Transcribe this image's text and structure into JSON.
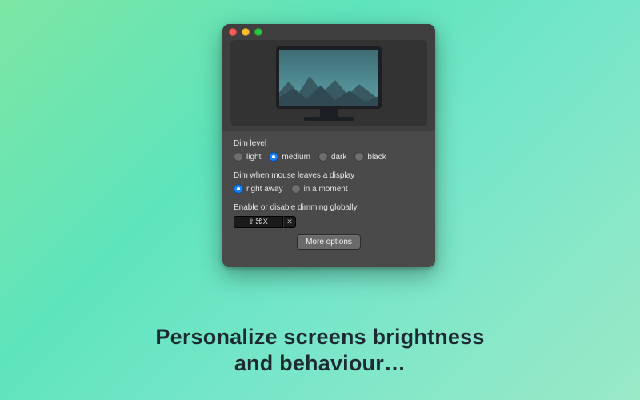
{
  "caption_line1": "Personalize screens brightness",
  "caption_line2": "and behaviour…",
  "window": {
    "settings": {
      "dim_level": {
        "label": "Dim level",
        "options": [
          {
            "label": "light",
            "selected": false
          },
          {
            "label": "medium",
            "selected": true
          },
          {
            "label": "dark",
            "selected": false
          },
          {
            "label": "black",
            "selected": false
          }
        ]
      },
      "dim_when": {
        "label": "Dim when mouse leaves a display",
        "options": [
          {
            "label": "right away",
            "selected": true
          },
          {
            "label": "in a moment",
            "selected": false
          }
        ]
      },
      "global_toggle": {
        "label": "Enable or disable dimming globally",
        "shortcut_display": "⇧⌘X",
        "clear_glyph": "✕"
      }
    },
    "more_button_label": "More options"
  }
}
